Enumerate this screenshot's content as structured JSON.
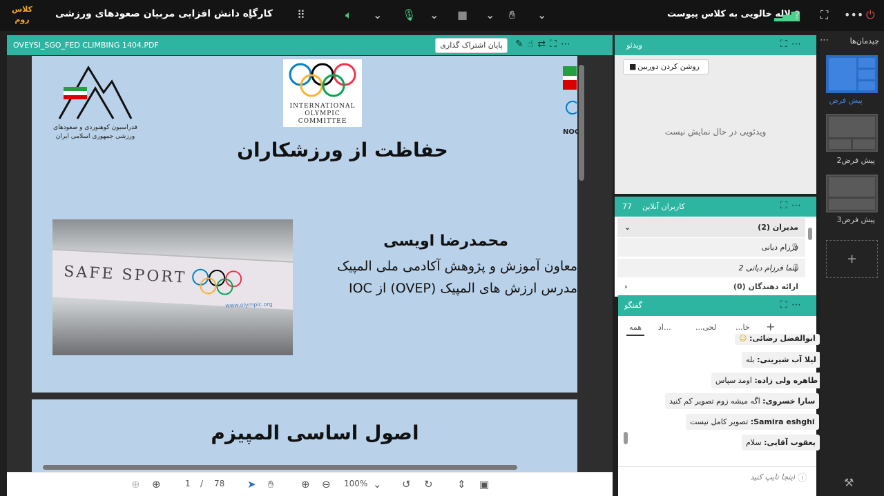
{
  "app": {
    "logo_line1": "کلاس",
    "logo_line2": "روم",
    "class_title": "کارگاه دانش افزایی مربیان صعودهای ورزشی",
    "join_message": "لاله خالویی به کلاس پیوست"
  },
  "colors": {
    "accent": "#2eb5a2",
    "topbar": "#141414",
    "slide_bg": "#b9d2ea",
    "layout_active": "#2b6cc4"
  },
  "pdf": {
    "file_name": "OVEYSI_SGO_FED CLIMBING 1404.PDF",
    "end_share_label": "پایان اشتراک گذاری",
    "page_current": "1",
    "page_separator": "/",
    "page_total": "78",
    "zoom": "100%"
  },
  "slide1": {
    "ioc_line1": "INTERNATIONAL",
    "ioc_line2": "OLYMPIC",
    "ioc_line3": "COMMITTEE",
    "federation_text": "فدراسیون کوهنوردی و صعودهای ورزشی جمهوری اسلامی ایران",
    "title": "حفاظت از ورزشکاران",
    "photo_banner": "SAFE SPORT",
    "photo_site": "www.olympic.org",
    "speaker_name": "محمدرضا اویسی",
    "speaker_role1": "معاون آموزش و پژوهش آکادمی ملی المپیک",
    "speaker_role2": "مدرس ارزش های المپیک  (OVEP) از IOC",
    "noc_label": "NOC"
  },
  "slide2": {
    "title": "اصول اساسی المپیزم"
  },
  "video": {
    "title": "ویدئو",
    "camera_button": "روشن کردن دوربین",
    "empty_message": "ویدئویی در حال نمایش نیست"
  },
  "users": {
    "title": "کاربران آنلاین",
    "count": "77",
    "group_admins": "مدیران (2)",
    "admin1": "فرزام دیانی",
    "admin2": "شما فرزام دیانی 2",
    "group_presenters": "ارائه دهندگان (0)"
  },
  "chat": {
    "title": "گفتگو",
    "tabs": [
      "همه",
      "خا...",
      "لحی...",
      "...اد"
    ],
    "messages": [
      {
        "sender": "ابوالفضل رضائی:",
        "text": ""
      },
      {
        "sender": "لیلا آب شیرینی:",
        "text": "بله"
      },
      {
        "sender": "طاهره ولی زاده:",
        "text": "اومد سپاس"
      },
      {
        "sender": "سارا خسروی:",
        "text": "اگه میشه زوم تصویر کم کنید"
      },
      {
        "sender": "Samira eshghi:",
        "text": "تصویر کامل نیست"
      },
      {
        "sender": "یعقوب آقایی:",
        "text": "سلام"
      }
    ],
    "input_placeholder": "اینجا تایپ کنید"
  },
  "layouts": {
    "title": "چیدمان‌ها",
    "items": [
      {
        "label": "پیش فرض"
      },
      {
        "label": "پیش فرض2"
      },
      {
        "label": "پیش فرض3"
      }
    ],
    "add_label": "+"
  }
}
